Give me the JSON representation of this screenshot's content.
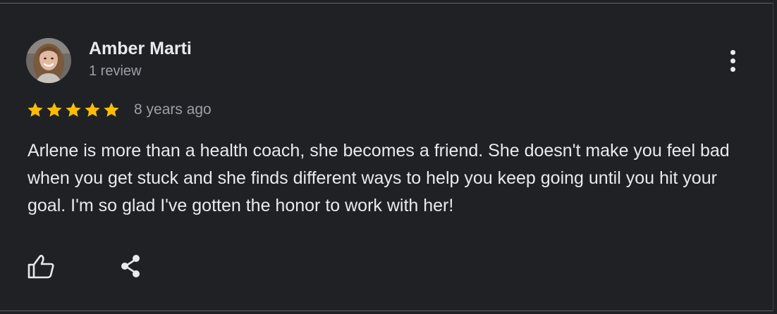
{
  "review": {
    "author_name": "Amber Marti",
    "review_count": "1 review",
    "rating": 5,
    "rating_max": 5,
    "time_ago": "8 years ago",
    "text": "Arlene is more than a health coach, she becomes a friend. She doesn't make you feel bad when you get stuck and she finds different ways to help you keep going until you hit your goal. I'm so glad I've gotten the honor to work with her!"
  },
  "icons": {
    "more": "more-vert-icon",
    "star": "star-icon",
    "like": "thumb-up-icon",
    "share": "share-icon"
  },
  "colors": {
    "background": "#202124",
    "text_primary": "#e8eaed",
    "text_secondary": "#9aa0a6",
    "star": "#fbbc04"
  }
}
